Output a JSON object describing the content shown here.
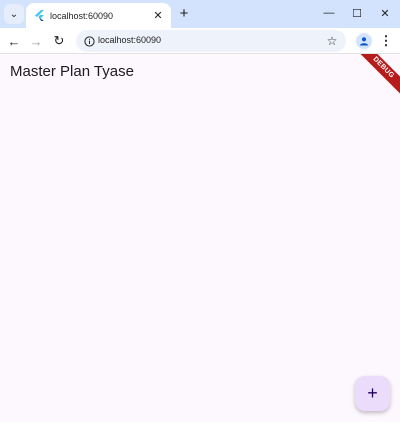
{
  "browser": {
    "tab": {
      "title": "localhost:60090",
      "close_glyph": "✕"
    },
    "new_tab_glyph": "+",
    "window_controls": {
      "minimize_glyph": "—",
      "maximize_glyph": "☐",
      "close_glyph": "✕"
    },
    "nav": {
      "back_glyph": "←",
      "forward_glyph": "→",
      "reload_glyph": "↻"
    },
    "address_bar": {
      "url": "localhost:60090"
    },
    "bookmark_glyph": "☆",
    "menu_glyph": "⋮",
    "colors": {
      "tabstrip": "#d3e3fd",
      "flutter_logo": "#45c5f4"
    }
  },
  "app": {
    "title": "Master Plan Tyase",
    "debug_banner": "DEBUG",
    "fab_icon": "add-icon",
    "fab_glyph": "+",
    "colors": {
      "background": "#fdf7fe",
      "fab": "#ecdcfc",
      "debug_banner": "#b71c1c"
    }
  }
}
